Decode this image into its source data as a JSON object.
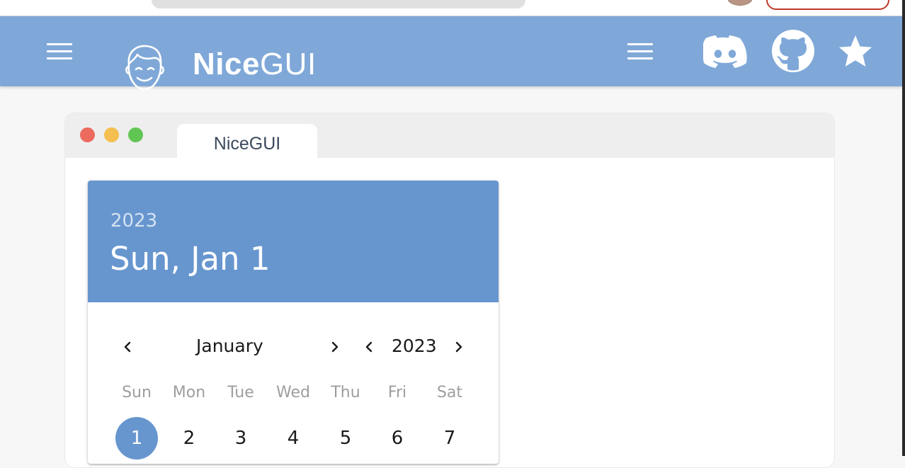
{
  "header": {
    "brand_bold": "Nice",
    "brand_light": "GUI",
    "icons": [
      "menu-icon",
      "nicegui-logo-icon",
      "menu-icon",
      "discord-icon",
      "github-icon",
      "star-icon"
    ],
    "background": "#7fa8d8"
  },
  "window": {
    "tab_label": "NiceGUI",
    "traffic_lights": [
      "#ec6a5e",
      "#f4bf4f",
      "#61c554"
    ]
  },
  "date_picker": {
    "year": "2023",
    "selected_label": "Sun, Jan 1",
    "month_label": "January",
    "year_label": "2023",
    "weekdays": [
      "Sun",
      "Mon",
      "Tue",
      "Wed",
      "Thu",
      "Fri",
      "Sat"
    ],
    "days_first_row": [
      "1",
      "2",
      "3",
      "4",
      "5",
      "6",
      "7"
    ],
    "selected_day": "1",
    "accent": "#6796cf"
  }
}
